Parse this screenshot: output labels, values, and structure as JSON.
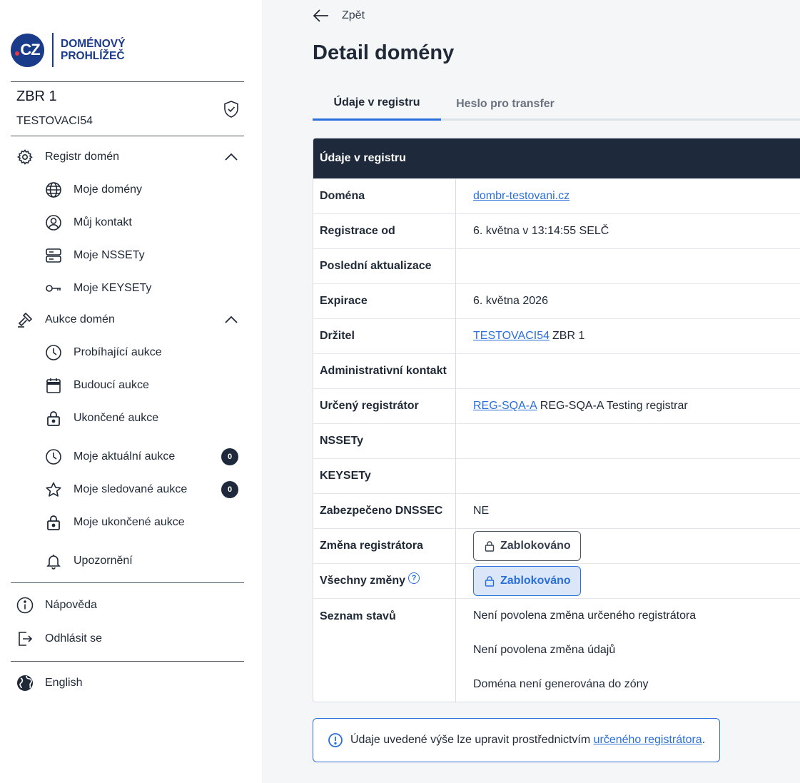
{
  "logo": {
    "cz": "CZ",
    "line1": "DOMÉNOVÝ",
    "line2": "PROHLÍŽEČ"
  },
  "user": {
    "name": "ZBR 1",
    "handle": "TESTOVACI54"
  },
  "sidebar": {
    "registry": {
      "label": "Registr domén",
      "items": [
        "Moje domény",
        "Můj kontakt",
        "Moje NSSETy",
        "Moje KEYSETy"
      ]
    },
    "auctions": {
      "label": "Aukce domén",
      "items": [
        "Probíhající aukce",
        "Budoucí aukce",
        "Ukončené aukce"
      ]
    },
    "my_auctions": [
      {
        "label": "Moje aktuální aukce",
        "badge": "0"
      },
      {
        "label": "Moje sledované aukce",
        "badge": "0"
      },
      {
        "label": "Moje ukončené aukce"
      }
    ],
    "notifications": "Upozornění",
    "help": "Nápověda",
    "logout": "Odhlásit se",
    "language": "English"
  },
  "main": {
    "back": "Zpět",
    "title": "Detail domény",
    "tabs": [
      "Údaje v registru",
      "Heslo pro transfer"
    ],
    "table": {
      "header": "Údaje v registru",
      "rows": {
        "domain": {
          "key": "Doména",
          "link": "dombr-testovani.cz"
        },
        "registered": {
          "key": "Registrace od",
          "value": "6. května v 13:14:55 SELČ"
        },
        "updated": {
          "key": "Poslední aktualizace",
          "value": ""
        },
        "expiration": {
          "key": "Expirace",
          "value": "6. května 2026"
        },
        "holder": {
          "key": "Držitel",
          "link": "TESTOVACI54",
          "value": "ZBR 1"
        },
        "admin": {
          "key": "Administrativní kontakt",
          "value": ""
        },
        "registrar": {
          "key": "Určený registrátor",
          "link": "REG-SQA-A",
          "value": "REG-SQA-A Testing registrar"
        },
        "nssets": {
          "key": "NSSETy",
          "value": ""
        },
        "keysets": {
          "key": "KEYSETy",
          "value": ""
        },
        "dnssec": {
          "key": "Zabezpečeno DNSSEC",
          "value": "NE"
        },
        "registrar_change": {
          "key": "Změna registrátora",
          "chip": "Zablokováno"
        },
        "all_changes": {
          "key": "Všechny změny",
          "help": "?",
          "chip": "Zablokováno"
        },
        "states": {
          "key": "Seznam stavů",
          "items": [
            "Není povolena změna určeného registrátora",
            "Není povolena změna údajů",
            "Doména není generována do zóny"
          ]
        }
      }
    },
    "info": {
      "text": "Údaje uvedené výše lze upravit prostřednictvím ",
      "link": "určeného registrátora",
      "suffix": "."
    }
  },
  "colors": {
    "navy": "#1e2a3c",
    "accent": "#2a6fdb",
    "brand": "#1a3a8a",
    "brand_red": "#e63946"
  }
}
